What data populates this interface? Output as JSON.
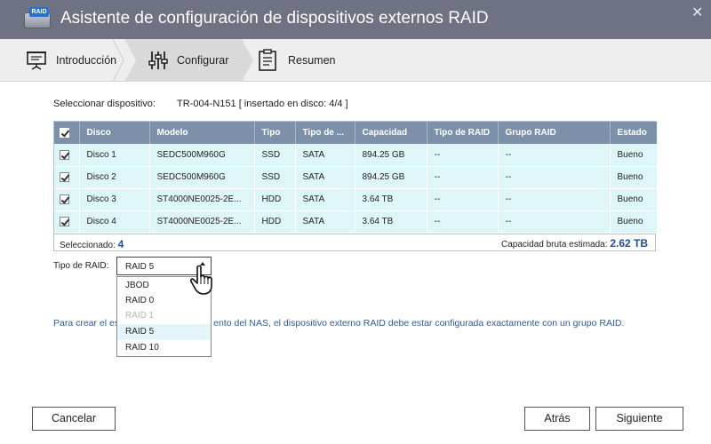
{
  "window": {
    "title": "Asistente de configuración de dispositivos externos RAID",
    "icon_tag": "RAID"
  },
  "steps": [
    {
      "label": "Introducción",
      "icon": "presentation-board-icon",
      "active": false
    },
    {
      "label": "Configurar",
      "icon": "sliders-icon",
      "active": true
    },
    {
      "label": "Resumen",
      "icon": "clipboard-icon",
      "active": false
    }
  ],
  "device": {
    "label": "Seleccionar dispositivo:",
    "value": "TR-004-N151 [ insertado en disco: 4/4 ]"
  },
  "table": {
    "headers": [
      "Disco",
      "Modelo",
      "Tipo",
      "Tipo de ...",
      "Capacidad",
      "Tipo de RAID",
      "Grupo RAID",
      "Estado"
    ],
    "rows": [
      {
        "checked": true,
        "cells": [
          "Disco 1",
          "SEDC500M960G",
          "SSD",
          "SATA",
          "894.25 GB",
          "--",
          "--",
          "Bueno"
        ]
      },
      {
        "checked": true,
        "cells": [
          "Disco 2",
          "SEDC500M960G",
          "SSD",
          "SATA",
          "894.25 GB",
          "--",
          "--",
          "Bueno"
        ]
      },
      {
        "checked": true,
        "cells": [
          "Disco 3",
          "ST4000NE0025-2E...",
          "HDD",
          "SATA",
          "3.64 TB",
          "--",
          "--",
          "Bueno"
        ]
      },
      {
        "checked": true,
        "cells": [
          "Disco 4",
          "ST4000NE0025-2E...",
          "HDD",
          "SATA",
          "3.64 TB",
          "--",
          "--",
          "Bueno"
        ]
      }
    ],
    "footer": {
      "selected_label": "Seleccionado:",
      "selected_count": "4",
      "capacity_label": "Capacidad bruta estimada:",
      "capacity_value": "2.62 TB"
    }
  },
  "raid": {
    "label": "Tipo de RAID:",
    "selected": "RAID 5",
    "options": [
      {
        "label": "JBOD",
        "disabled": false,
        "selected": false
      },
      {
        "label": "RAID 0",
        "disabled": false,
        "selected": false
      },
      {
        "label": "RAID 1",
        "disabled": true,
        "selected": false
      },
      {
        "label": "RAID 5",
        "disabled": false,
        "selected": true
      },
      {
        "label": "RAID 10",
        "disabled": false,
        "selected": false
      }
    ]
  },
  "info": {
    "before": "Para crear el es",
    "after": "ento del NAS, el dispositivo externo RAID debe estar configurada exactamente con un grupo RAID."
  },
  "buttons": {
    "cancel": "Cancelar",
    "back": "Atrás",
    "next": "Siguiente"
  },
  "colors": {
    "titlebar": "#6e7282",
    "table_header": "#7c91a9",
    "row_bg": "#dff6f8",
    "info_text": "#2e5b98"
  }
}
